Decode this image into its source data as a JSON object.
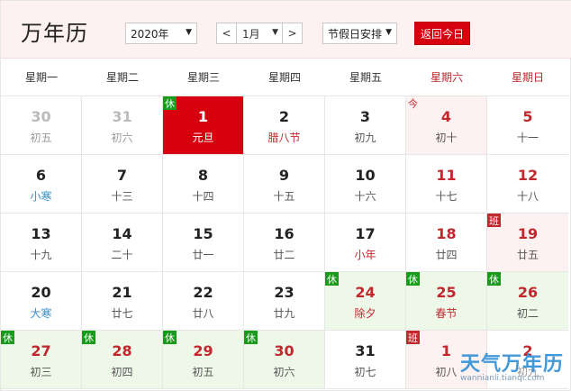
{
  "header": {
    "title": "万年历",
    "year_value": "2020年",
    "month_prev": "<",
    "month_value": "1月",
    "month_next": ">",
    "holiday_value": "节假日安排",
    "today_button": "返回今日"
  },
  "weekdays": [
    {
      "label": "星期一",
      "weekend": false
    },
    {
      "label": "星期二",
      "weekend": false
    },
    {
      "label": "星期三",
      "weekend": false
    },
    {
      "label": "星期四",
      "weekend": false
    },
    {
      "label": "星期五",
      "weekend": false
    },
    {
      "label": "星期六",
      "weekend": true
    },
    {
      "label": "星期日",
      "weekend": true
    }
  ],
  "weeks": [
    [
      {
        "day": "30",
        "lunar": "初五",
        "kind": "other"
      },
      {
        "day": "31",
        "lunar": "初六",
        "kind": "other"
      },
      {
        "day": "1",
        "lunar": "元旦",
        "kind": "selected",
        "tag": "休",
        "tagType": "rest"
      },
      {
        "day": "2",
        "lunar": "腊八节",
        "kind": "festival"
      },
      {
        "day": "3",
        "lunar": "初九",
        "kind": "normal"
      },
      {
        "day": "4",
        "lunar": "初十",
        "kind": "weekend",
        "tag": "今",
        "tagType": "today"
      },
      {
        "day": "5",
        "lunar": "十一",
        "kind": "weekend"
      }
    ],
    [
      {
        "day": "6",
        "lunar": "小寒",
        "kind": "term"
      },
      {
        "day": "7",
        "lunar": "十三",
        "kind": "normal"
      },
      {
        "day": "8",
        "lunar": "十四",
        "kind": "normal"
      },
      {
        "day": "9",
        "lunar": "十五",
        "kind": "normal"
      },
      {
        "day": "10",
        "lunar": "十六",
        "kind": "normal"
      },
      {
        "day": "11",
        "lunar": "十七",
        "kind": "weekend"
      },
      {
        "day": "12",
        "lunar": "十八",
        "kind": "weekend"
      }
    ],
    [
      {
        "day": "13",
        "lunar": "十九",
        "kind": "normal"
      },
      {
        "day": "14",
        "lunar": "二十",
        "kind": "normal"
      },
      {
        "day": "15",
        "lunar": "廿一",
        "kind": "normal"
      },
      {
        "day": "16",
        "lunar": "廿二",
        "kind": "normal"
      },
      {
        "day": "17",
        "lunar": "小年",
        "kind": "festival"
      },
      {
        "day": "18",
        "lunar": "廿四",
        "kind": "weekend"
      },
      {
        "day": "19",
        "lunar": "廿五",
        "kind": "work",
        "tag": "班",
        "tagType": "work"
      }
    ],
    [
      {
        "day": "20",
        "lunar": "大寒",
        "kind": "term"
      },
      {
        "day": "21",
        "lunar": "廿七",
        "kind": "normal"
      },
      {
        "day": "22",
        "lunar": "廿八",
        "kind": "normal"
      },
      {
        "day": "23",
        "lunar": "廿九",
        "kind": "normal"
      },
      {
        "day": "24",
        "lunar": "除夕",
        "kind": "rest-festival",
        "tag": "休",
        "tagType": "rest"
      },
      {
        "day": "25",
        "lunar": "春节",
        "kind": "rest-festival",
        "tag": "休",
        "tagType": "rest"
      },
      {
        "day": "26",
        "lunar": "初二",
        "kind": "rest",
        "tag": "休",
        "tagType": "rest"
      }
    ],
    [
      {
        "day": "27",
        "lunar": "初三",
        "kind": "rest",
        "tag": "休",
        "tagType": "rest"
      },
      {
        "day": "28",
        "lunar": "初四",
        "kind": "rest",
        "tag": "休",
        "tagType": "rest"
      },
      {
        "day": "29",
        "lunar": "初五",
        "kind": "rest",
        "tag": "休",
        "tagType": "rest"
      },
      {
        "day": "30",
        "lunar": "初六",
        "kind": "rest",
        "tag": "休",
        "tagType": "rest"
      },
      {
        "day": "31",
        "lunar": "初七",
        "kind": "normal"
      },
      {
        "day": "1",
        "lunar": "初八",
        "kind": "work",
        "tag": "班",
        "tagType": "work"
      },
      {
        "day": "2",
        "lunar": "初九",
        "kind": "other-weekend"
      }
    ]
  ],
  "watermark": {
    "main": "天气万年历",
    "sub": "wannianli.tianqi.com"
  },
  "colors": {
    "accent": "#d7000f",
    "weekend": "#c1272d",
    "rest_bg": "#eef8e8",
    "rest_tag": "#1a9a1a",
    "header_bg": "#fdf1f1",
    "solar_term": "#3a8fc9"
  }
}
